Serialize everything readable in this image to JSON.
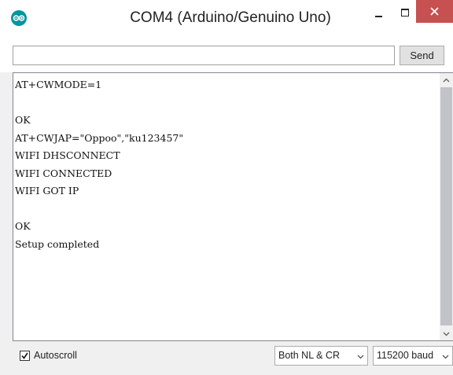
{
  "window": {
    "title": "COM4 (Arduino/Genuino Uno)"
  },
  "input": {
    "value": "",
    "placeholder": ""
  },
  "send_button": {
    "label": "Send"
  },
  "output": {
    "lines": [
      "AT+CWMODE=1",
      "",
      "OK",
      "AT+CWJAP=\"Oppoo\",\"ku123457\"",
      "WIFI DHSCONNECT",
      "WIFI CONNECTED",
      "WIFI GOT IP",
      "",
      "OK",
      "Setup completed"
    ]
  },
  "bottom": {
    "autoscroll_label": "Autoscroll",
    "autoscroll_checked": true,
    "line_ending": "Both NL & CR",
    "baud": "115200 baud"
  },
  "icons": {
    "app": "arduino-icon",
    "minimize": "minimize-icon",
    "maximize": "maximize-icon",
    "close": "close-icon",
    "scroll_up": "chevron-up-icon",
    "scroll_down": "chevron-down-icon"
  },
  "colors": {
    "accent": "#00979d",
    "close_button": "#c75050",
    "scroll_thumb": "#c2c3c9"
  }
}
